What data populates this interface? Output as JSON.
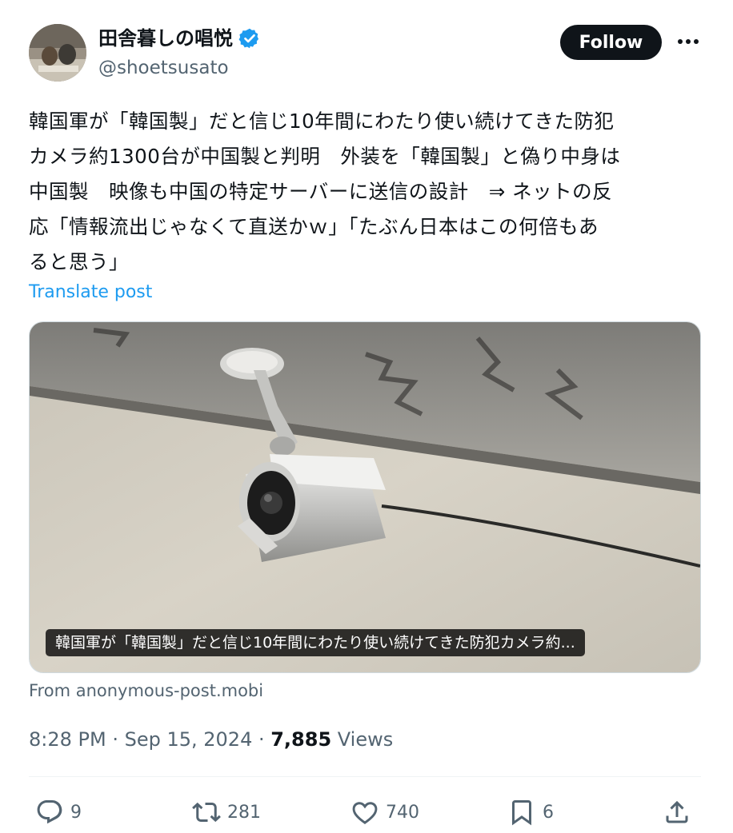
{
  "author": {
    "display_name": "田舎暮しの唱悦",
    "handle": "@shoetsusato"
  },
  "follow_label": "Follow",
  "post": {
    "text": "韓国軍が「韓国製」だと信じ10年間にわたり使い続けてきた防犯\nカメラ約1300台が中国製と判明　外装を「韓国製」と偽り中身は\n中国製　映像も中国の特定サーバーに送信の設計　⇒ ネットの反\n応「情報流出じゃなくて直送かｗ」「たぶん日本はこの何倍もあ\nると思う」",
    "translate_label": "Translate post"
  },
  "media": {
    "caption": "韓国軍が「韓国製」だと信じ10年間にわたり使い続けてきた防犯カメラ約...",
    "source": "From anonymous-post.mobi"
  },
  "meta": {
    "time": "8:28 PM",
    "sep1": " · ",
    "date": "Sep 15, 2024",
    "sep2": " · ",
    "views": "7,885",
    "views_label": " Views"
  },
  "actions": {
    "replies": "9",
    "reposts": "281",
    "likes": "740",
    "bookmarks": "6"
  },
  "colors": {
    "accent": "#1d9bf0",
    "text": "#0f1419",
    "muted": "#536471"
  }
}
